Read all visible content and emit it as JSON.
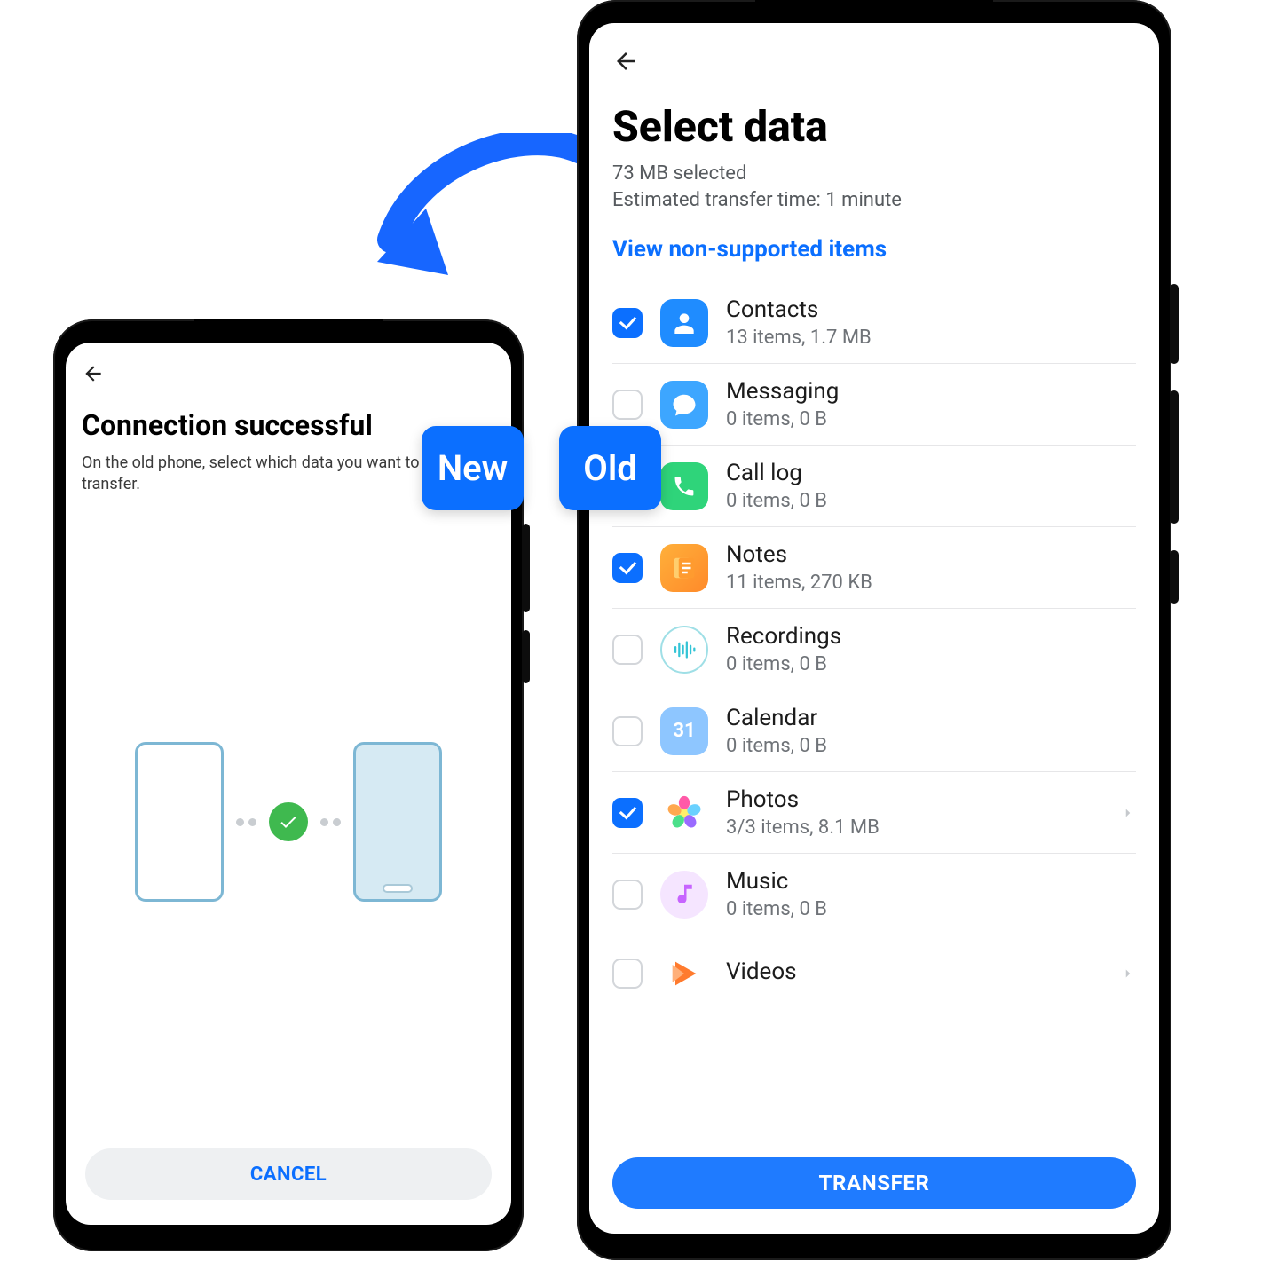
{
  "overlay": {
    "new_label": "New",
    "old_label": "Old"
  },
  "left": {
    "title": "Connection successful",
    "subtitle": "On the old phone, select which data you want to transfer.",
    "cancel": "CANCEL"
  },
  "right": {
    "title": "Select data",
    "selected": "73 MB selected",
    "eta": "Estimated transfer time: 1 minute",
    "unsupported_link": "View non-supported items",
    "transfer": "TRANSFER",
    "items": [
      {
        "name": "Contacts",
        "detail": "13 items, 1.7 MB",
        "checked": true,
        "chevron": false,
        "icon": "contacts"
      },
      {
        "name": "Messaging",
        "detail": "0 items, 0 B",
        "checked": false,
        "chevron": false,
        "icon": "msg"
      },
      {
        "name": "Call log",
        "detail": "0 items, 0 B",
        "checked": false,
        "chevron": false,
        "icon": "call"
      },
      {
        "name": "Notes",
        "detail": "11 items, 270 KB",
        "checked": true,
        "chevron": false,
        "icon": "notes"
      },
      {
        "name": "Recordings",
        "detail": "0 items, 0 B",
        "checked": false,
        "chevron": false,
        "icon": "rec"
      },
      {
        "name": "Calendar",
        "detail": "0 items, 0 B",
        "checked": false,
        "chevron": false,
        "icon": "cal",
        "icon_text": "31"
      },
      {
        "name": "Photos",
        "detail": "3/3 items, 8.1 MB",
        "checked": true,
        "chevron": true,
        "icon": "photos"
      },
      {
        "name": "Music",
        "detail": "0 items, 0 B",
        "checked": false,
        "chevron": false,
        "icon": "music"
      },
      {
        "name": "Videos",
        "detail": "",
        "checked": false,
        "chevron": true,
        "icon": "videos"
      }
    ]
  }
}
